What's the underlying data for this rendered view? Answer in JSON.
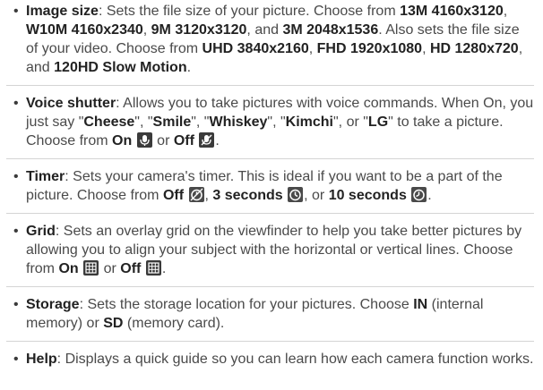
{
  "items": [
    {
      "term": "Image size",
      "parts": [
        ": Sets the file size of your picture. Choose from ",
        "13M 4160x3120",
        ", ",
        "W10M 4160x2340",
        ", ",
        "9M 3120x3120",
        ", and ",
        "3M 2048x1536",
        ". Also sets the file size of your video. Choose from ",
        "UHD 3840x2160",
        ", ",
        "FHD 1920x1080",
        ", ",
        "HD 1280x720",
        ", and ",
        "120HD Slow Motion",
        "."
      ]
    },
    {
      "term": "Voice shutter",
      "parts": [
        ": Allows you to take pictures with voice commands. When On, you just say \"",
        "Cheese",
        "\", \"",
        "Smile",
        "\", \"",
        "Whiskey",
        "\", \"",
        "Kimchi",
        "\", or \"",
        "LG",
        "\" to take a picture. Choose from ",
        "On",
        " ",
        " or ",
        "Off",
        " ",
        "."
      ]
    },
    {
      "term": "Timer",
      "parts": [
        ": Sets your camera's timer. This is ideal if you want to be a part of the picture. Choose from ",
        "Off",
        " ",
        ", ",
        "3 seconds",
        " ",
        ", or ",
        "10 seconds",
        " ",
        "."
      ]
    },
    {
      "term": "Grid",
      "parts": [
        ": Sets an overlay grid on the viewfinder to help you take better pictures by allowing you to align your subject with the horizontal or vertical lines. Choose from ",
        "On",
        " ",
        " or ",
        "Off",
        " ",
        "."
      ]
    },
    {
      "term": "Storage",
      "parts": [
        ": Sets the storage location for your pictures. Choose ",
        "IN",
        " (internal memory) or ",
        "SD",
        " (memory card)."
      ]
    },
    {
      "term": "Help",
      "parts": [
        ": Displays a quick guide so you can learn how each camera function works."
      ]
    }
  ],
  "icons": {
    "voice_on": "voice-shutter-on-icon",
    "voice_off": "voice-shutter-off-icon",
    "timer_off": "timer-off-icon",
    "timer_3": "timer-3s-icon",
    "timer_10": "timer-10s-icon",
    "grid_on": "grid-on-icon",
    "grid_off": "grid-off-icon"
  }
}
